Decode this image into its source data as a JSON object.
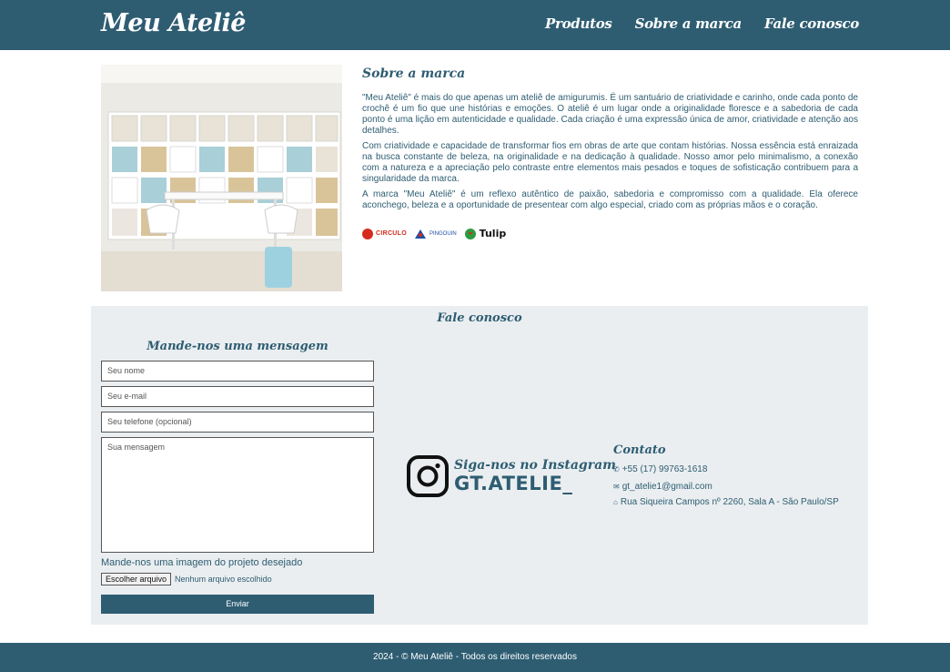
{
  "header": {
    "logo": "Meu Ateliê",
    "nav": [
      "Produtos",
      "Sobre a marca",
      "Fale conosco"
    ]
  },
  "about": {
    "title": "Sobre a marca",
    "paragraphs": [
      "\"Meu Ateliê\" é mais do que apenas um ateliê de amigurumis. É um santuário de criatividade e carinho, onde cada ponto de crochê é um fio que une histórias e emoções. O ateliê é um lugar onde a originalidade floresce e a sabedoria de cada ponto é uma lição em autenticidade e qualidade. Cada criação é uma expressão única de amor, criatividade e atenção aos detalhes.",
      "Com criatividade e capacidade de transformar fios em obras de arte que contam histórias. Nossa essência está enraizada na busca constante de beleza, na originalidade e na dedicação à qualidade. Nosso amor pelo minimalismo, a conexão com a natureza e a apreciação pelo contraste entre elementos mais pesados e toques de sofisticação contribuem para a singularidade da marca.",
      "A marca \"Meu Ateliê\" é um reflexo autêntico de paixão, sabedoria e compromisso com a qualidade. Ela oferece aconchego, beleza e a oportunidade de presentear com algo especial, criado com as próprias mãos e o coração."
    ],
    "brands": [
      "CIRCULO",
      "PINGOUIN",
      "Tulip"
    ]
  },
  "contact": {
    "title": "Fale conosco",
    "form": {
      "title": "Mande-nos uma mensagem",
      "name_placeholder": "Seu nome",
      "email_placeholder": "Seu e-mail",
      "phone_placeholder": "Seu telefone (opcional)",
      "message_placeholder": "Sua mensagem",
      "file_label": "Mande-nos uma imagem do projeto desejado",
      "file_button": "Escolher arquivo",
      "file_status": "Nenhum arquivo escolhido",
      "submit": "Enviar"
    },
    "instagram": {
      "follow": "Siga-nos no Instagram",
      "handle": "GT.ATELIE_"
    },
    "info": {
      "title": "Contato",
      "phone": "+55 (17) 99763-1618",
      "email": "gt_atelie1@gmail.com",
      "address": "Rua Siqueira Campos nº 2260, Sala A - São Paulo/SP"
    }
  },
  "footer": {
    "text": "2024 - © Meu Ateliê - Todos os direitos reservados"
  },
  "colors": {
    "primary": "#2e5d72",
    "section_bg": "#eaeef0"
  }
}
